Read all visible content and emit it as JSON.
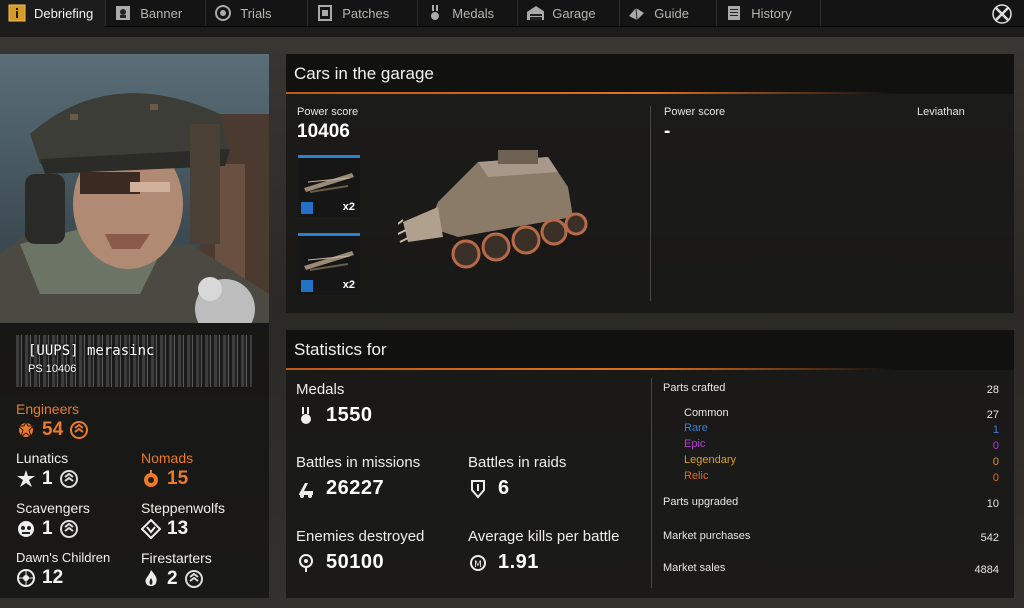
{
  "nav": {
    "tabs": [
      {
        "label": "Debriefing",
        "icon": "info-icon",
        "active": true
      },
      {
        "label": "Banner",
        "icon": "banner-icon"
      },
      {
        "label": "Trials",
        "icon": "trials-icon"
      },
      {
        "label": "Patches",
        "icon": "patches-icon"
      },
      {
        "label": "Medals",
        "icon": "medals-icon"
      },
      {
        "label": "Garage",
        "icon": "garage-icon"
      },
      {
        "label": "Guide",
        "icon": "guide-icon"
      },
      {
        "label": "History",
        "icon": "history-icon"
      }
    ]
  },
  "player": {
    "name": "[UUPS] merasinc",
    "ps": "PS 10406",
    "factions": {
      "engineers": {
        "label": "Engineers",
        "level": "54"
      },
      "lunatics": {
        "label": "Lunatics",
        "level": "1"
      },
      "nomads": {
        "label": "Nomads",
        "level": "15"
      },
      "scavengers": {
        "label": "Scavengers",
        "level": "1"
      },
      "steppenwolfs": {
        "label": "Steppenwolfs",
        "level": "13"
      },
      "dawns_children": {
        "label": "Dawn's Children",
        "level": "12"
      },
      "firestarters": {
        "label": "Firestarters",
        "level": "2"
      }
    }
  },
  "garage": {
    "title": "Cars in the garage",
    "left": {
      "power_label": "Power score",
      "power_value": "10406",
      "weapons": [
        {
          "qty": "x2"
        },
        {
          "qty": "x2"
        }
      ]
    },
    "right": {
      "power_label": "Power score",
      "power_value": "-",
      "cabin": "Leviathan"
    }
  },
  "stats": {
    "title": "Statistics for",
    "medals": {
      "label": "Medals",
      "value": "1550"
    },
    "battles_missions": {
      "label": "Battles in missions",
      "value": "26227"
    },
    "battles_raids": {
      "label": "Battles in raids",
      "value": "6"
    },
    "enemies": {
      "label": "Enemies destroyed",
      "value": "50100"
    },
    "avg_kills": {
      "label": "Average kills per battle",
      "value": "1.91"
    },
    "parts_crafted": {
      "label": "Parts crafted",
      "value": "28"
    },
    "common": {
      "label": "Common",
      "value": "27"
    },
    "rare": {
      "label": "Rare",
      "value": "1"
    },
    "epic": {
      "label": "Epic",
      "value": "0"
    },
    "legendary": {
      "label": "Legendary",
      "value": "0"
    },
    "relic": {
      "label": "Relic",
      "value": "0"
    },
    "parts_upgraded": {
      "label": "Parts upgraded",
      "value": "10"
    },
    "market_purchases": {
      "label": "Market purchases",
      "value": "542"
    },
    "market_sales": {
      "label": "Market sales",
      "value": "4884"
    }
  },
  "colors": {
    "accent": "#ea7a2c",
    "rare": "#3d7fd6",
    "epic": "#b23fd2",
    "legendary": "#d9a020",
    "relic": "#e06a2a"
  }
}
